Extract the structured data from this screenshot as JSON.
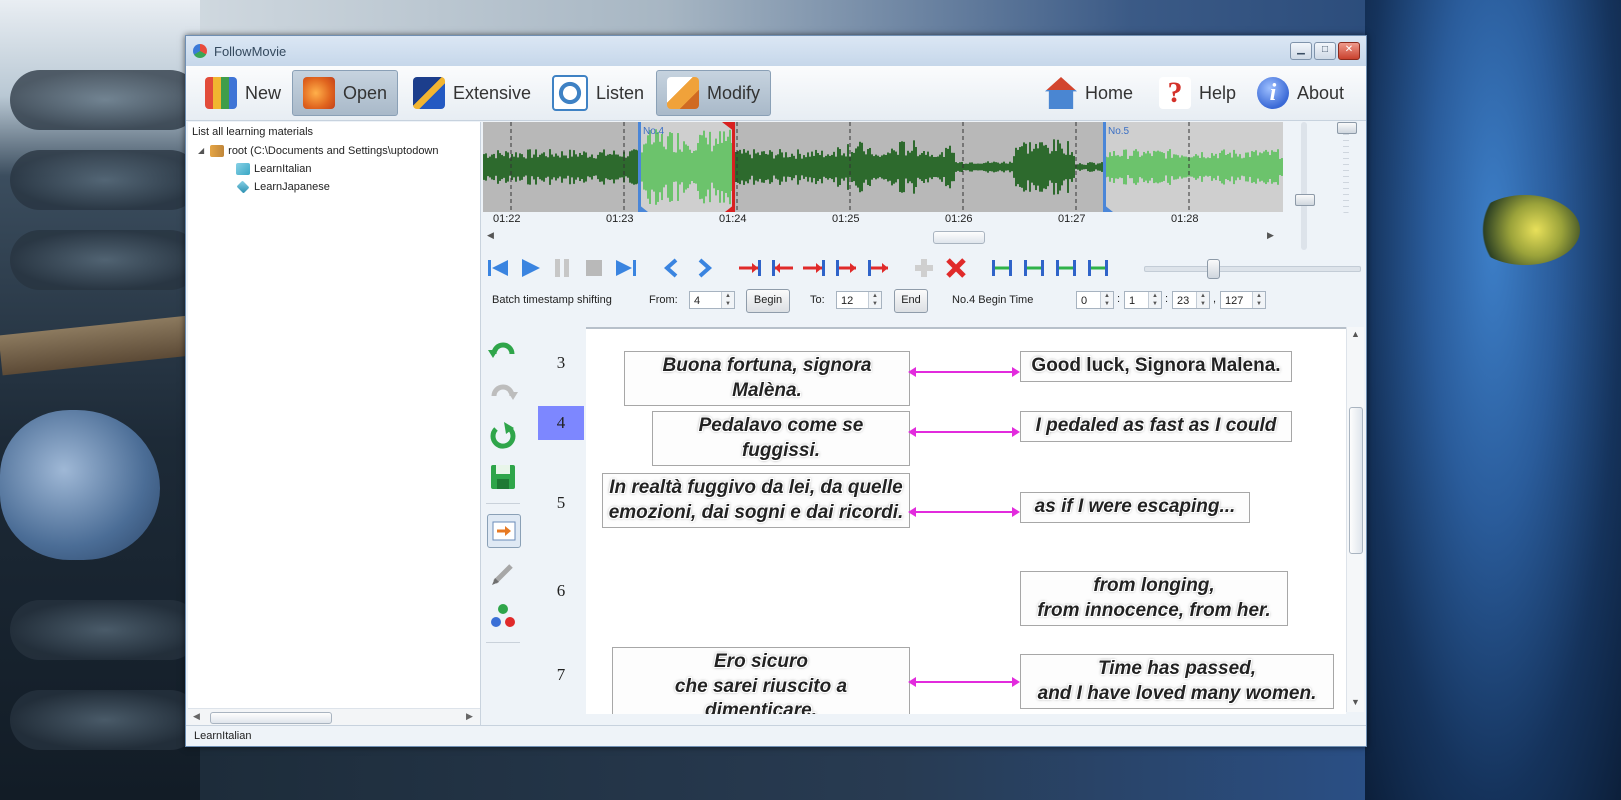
{
  "window": {
    "title": "FollowMovie"
  },
  "toolbar": {
    "items": [
      {
        "label": "New",
        "icon": "books-icon",
        "active": false
      },
      {
        "label": "Open",
        "icon": "open-folder-icon",
        "active": true
      },
      {
        "label": "Extensive",
        "icon": "reading-icon",
        "active": false
      },
      {
        "label": "Listen",
        "icon": "headphones-icon",
        "active": false
      },
      {
        "label": "Modify",
        "icon": "edit-icon",
        "active": true
      }
    ],
    "right_items": [
      {
        "label": "Home",
        "icon": "home-icon"
      },
      {
        "label": "Help",
        "icon": "help-icon"
      },
      {
        "label": "About",
        "icon": "info-icon"
      }
    ]
  },
  "left_panel": {
    "header": "List all learning materials",
    "root": "root (C:\\Documents and Settings\\uptodown",
    "children": [
      "LearnItalian",
      "LearnJapanese"
    ]
  },
  "waveform": {
    "ticks": [
      "01:22",
      "01:23",
      "01:24",
      "01:25",
      "01:26",
      "01:27",
      "01:28"
    ],
    "markers": [
      "No.4",
      "No.5"
    ]
  },
  "batch": {
    "label": "Batch timestamp shifting",
    "from_label": "From:",
    "from_value": "4",
    "begin_button": "Begin",
    "to_label": "To:",
    "to_value": "12",
    "end_button": "End",
    "begin_time_label": "No.4 Begin Time",
    "time": [
      "0",
      "1",
      "23",
      "127"
    ],
    "separators": [
      ":",
      ":",
      ","
    ]
  },
  "subtitles": [
    {
      "num": "3",
      "source": "Buona fortuna, signora Malèna.",
      "target": "Good luck, Signora Malena.",
      "linked": true
    },
    {
      "num": "4",
      "source": "Pedalavo come se fuggissi.",
      "target": "I pedaled as fast as I could",
      "linked": true,
      "selected": true
    },
    {
      "num": "5",
      "source": "In realtà fuggivo da lei, da quelle\nemozioni, dai sogni e dai ricordi.",
      "target": "as if I were escaping...",
      "linked": true
    },
    {
      "num": "6",
      "source": "",
      "target": "from longing,\nfrom innocence, from her.",
      "linked": false
    },
    {
      "num": "7",
      "source": "Ero sicuro\nche sarei riuscito a dimenticare.",
      "target": "Time has passed,\nand I have loved many women.",
      "linked": true
    }
  ],
  "statusbar": {
    "text": "LearnItalian"
  },
  "colors": {
    "link": "#e22bdd",
    "selected_row": "#7d87ff",
    "wave_dark": "#2d6a2d",
    "wave_light": "#6cc36c"
  }
}
